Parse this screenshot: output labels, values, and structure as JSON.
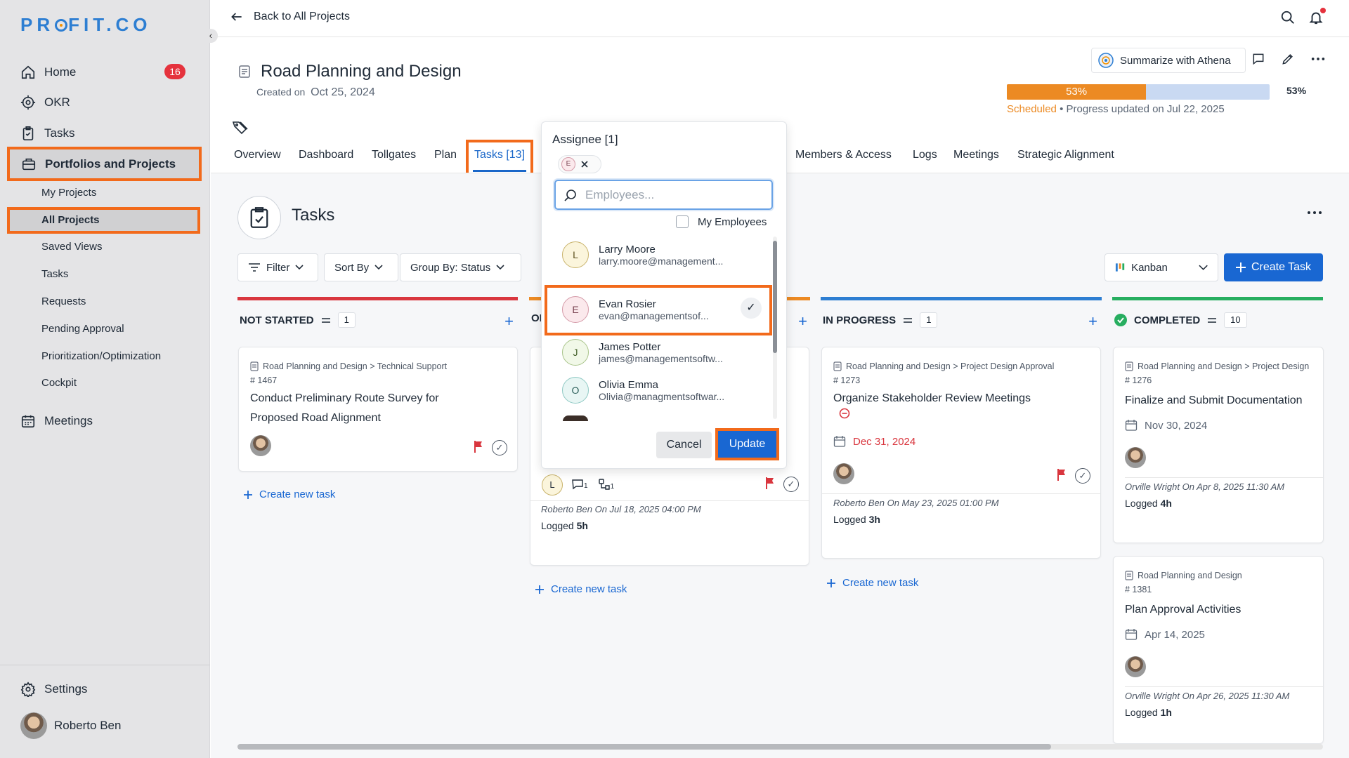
{
  "sidebar": {
    "logo": "PROFIT.CO",
    "home": "Home",
    "home_badge": "16",
    "okr": "OKR",
    "tasks": "Tasks",
    "portfolios": "Portfolios and Projects",
    "sub": [
      "My Projects",
      "All Projects",
      "Saved Views",
      "Tasks",
      "Requests",
      "Pending Approval",
      "Prioritization/Optimization",
      "Cockpit"
    ],
    "meetings": "Meetings",
    "settings": "Settings",
    "user": "Roberto Ben"
  },
  "header": {
    "back": "Back to All Projects",
    "project_title": "Road Planning and Design",
    "created_label": "Created on",
    "created_date": "Oct 25, 2024",
    "athena": "Summarize with Athena",
    "progress": 53,
    "progress_label": "53%",
    "progress_pct": "53%",
    "status": "Scheduled",
    "progress_note": "• Progress updated on Jul 22, 2025"
  },
  "tabs": {
    "overview": "Overview",
    "dashboard": "Dashboard",
    "tollgates": "Tollgates",
    "plan": "Plan",
    "tasks": "Tasks [13]",
    "members": "Members & Access",
    "logs": "Logs",
    "meetings": "Meetings",
    "strategic": "Strategic Alignment"
  },
  "tasks": {
    "title": "Tasks",
    "filter": "Filter",
    "sort": "Sort By",
    "group": "Group By: Status",
    "view": "Kanban",
    "create": "Create Task",
    "create_new": "Create new task"
  },
  "columns": {
    "not_started": {
      "title": "NOT STARTED",
      "count": "1",
      "color": "#d9363e"
    },
    "on_hold": {
      "title": "OI",
      "color": "#ec8a23"
    },
    "in_progress": {
      "title": "IN PROGRESS",
      "count": "1",
      "color": "#2d7ed2"
    },
    "completed": {
      "title": "COMPLETED",
      "count": "10",
      "color": "#27ae60"
    }
  },
  "cards": {
    "c1": {
      "crumb": "Road Planning and Design > Technical Support",
      "num": "# 1467",
      "name1": "Conduct Preliminary Route Survey for",
      "name2": "Proposed Road Alignment"
    },
    "c2": {
      "avatar": "L",
      "comments": "1",
      "sub": "1",
      "log": "Roberto Ben On Jul 18, 2025 04:00 PM",
      "logged_label": "Logged",
      "logged": "5h"
    },
    "c3": {
      "crumb": "Road Planning and Design > Project Design Approval",
      "num": "# 1273",
      "name": "Organize Stakeholder Review Meetings",
      "date": "Dec 31, 2024",
      "log": "Roberto Ben On May 23, 2025 01:00 PM",
      "logged_label": "Logged",
      "logged": "3h"
    },
    "c4": {
      "crumb": "Road Planning and Design > Project Design",
      "num": "# 1276",
      "name": "Finalize and Submit Documentation",
      "date": "Nov 30, 2024",
      "log": "Orville Wright On Apr 8, 2025 11:30 AM",
      "logged_label": "Logged",
      "logged": "4h"
    },
    "c5": {
      "crumb": "Road Planning and Design",
      "num": "# 1381",
      "name": "Plan Approval Activities",
      "date": "Apr 14, 2025",
      "log": "Orville Wright On Apr 26, 2025 11:30 AM",
      "logged_label": "Logged",
      "logged": "1h"
    }
  },
  "popover": {
    "title": "Assignee [1]",
    "chip": "E",
    "search_placeholder": "Employees...",
    "my_employees": "My Employees",
    "employees": [
      {
        "initial": "L",
        "name": "Larry Moore",
        "email": "larry.moore@management..."
      },
      {
        "initial": "E",
        "name": "Evan Rosier",
        "email": "evan@managementsof..."
      },
      {
        "initial": "J",
        "name": "James Potter",
        "email": "james@managementsoftw..."
      },
      {
        "initial": "O",
        "name": "Olivia Emma",
        "email": "Olivia@managmentsoftwar..."
      }
    ],
    "cancel": "Cancel",
    "update": "Update"
  }
}
